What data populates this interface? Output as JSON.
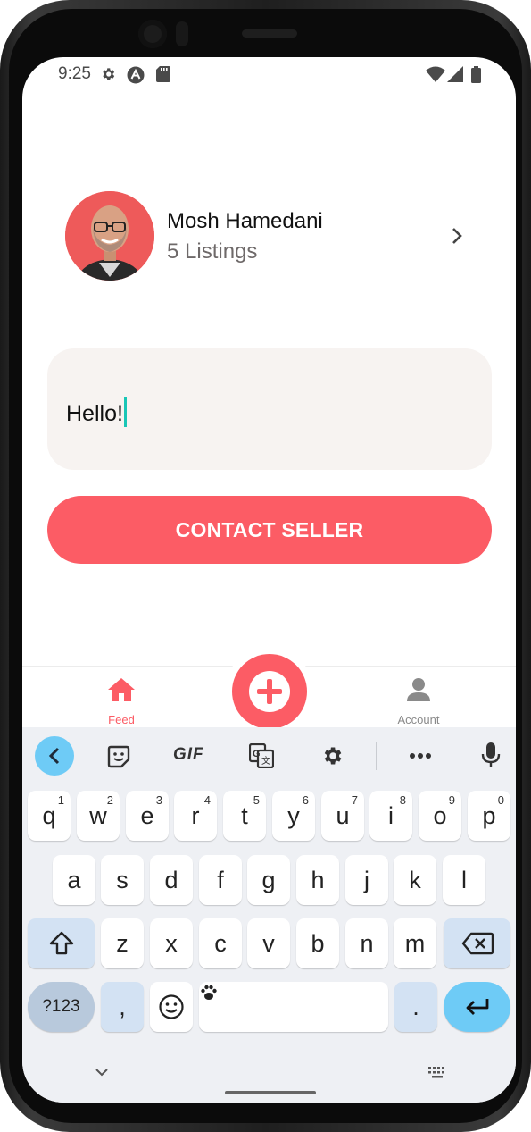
{
  "status_bar": {
    "time": "9:25",
    "icons": [
      "gear-icon",
      "app-notification-icon",
      "sd-card-icon",
      "wifi-icon",
      "signal-icon",
      "battery-icon"
    ]
  },
  "seller": {
    "name": "Mosh Hamedani",
    "listings": "5 Listings"
  },
  "message": {
    "value": "Hello!"
  },
  "contact_button": {
    "label": "CONTACT SELLER"
  },
  "tab_bar": {
    "tabs": [
      {
        "label": "Feed",
        "icon": "home-icon",
        "active": true
      },
      {
        "label": "Account",
        "icon": "account-icon",
        "active": false
      }
    ],
    "center_icon": "plus-circle-icon"
  },
  "keyboard": {
    "toolbar": [
      "back-chevron-icon",
      "sticker-icon",
      "GIF",
      "translate-icon",
      "settings-icon",
      "more-icon",
      "mic-icon"
    ],
    "row1": [
      {
        "key": "q",
        "sup": "1"
      },
      {
        "key": "w",
        "sup": "2"
      },
      {
        "key": "e",
        "sup": "3"
      },
      {
        "key": "r",
        "sup": "4"
      },
      {
        "key": "t",
        "sup": "5"
      },
      {
        "key": "y",
        "sup": "6"
      },
      {
        "key": "u",
        "sup": "7"
      },
      {
        "key": "i",
        "sup": "8"
      },
      {
        "key": "o",
        "sup": "9"
      },
      {
        "key": "p",
        "sup": "0"
      }
    ],
    "row2": [
      "a",
      "s",
      "d",
      "f",
      "g",
      "h",
      "j",
      "k",
      "l"
    ],
    "row3": [
      "z",
      "x",
      "c",
      "v",
      "b",
      "n",
      "m"
    ],
    "symbols_key": "?123",
    "comma_key": ",",
    "period_key": "."
  },
  "colors": {
    "primary": "#fc5c65",
    "input_background": "#f7f3f1",
    "caret": "#19c6b6",
    "tab_inactive": "#8a8a8a",
    "enter_key": "#6ecbf6"
  }
}
